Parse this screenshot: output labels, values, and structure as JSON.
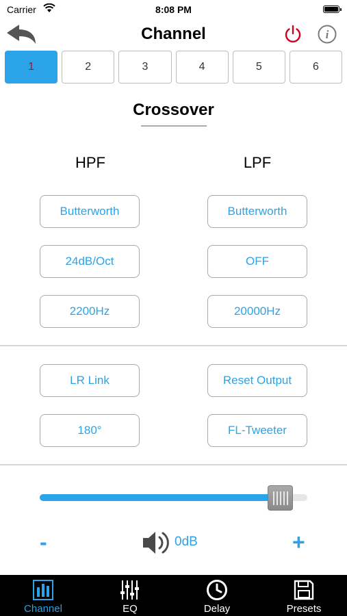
{
  "status_bar": {
    "carrier": "Carrier",
    "time": "8:08 PM"
  },
  "header": {
    "title": "Channel"
  },
  "channels": [
    {
      "label": "1",
      "active": true
    },
    {
      "label": "2",
      "active": false
    },
    {
      "label": "3",
      "active": false
    },
    {
      "label": "4",
      "active": false
    },
    {
      "label": "5",
      "active": false
    },
    {
      "label": "6",
      "active": false
    }
  ],
  "crossover": {
    "title": "Crossover",
    "hpf": {
      "heading": "HPF",
      "type": "Butterworth",
      "slope": "24dB/Oct",
      "frequency": "2200Hz"
    },
    "lpf": {
      "heading": "LPF",
      "type": "Butterworth",
      "slope": "OFF",
      "frequency": "20000Hz"
    }
  },
  "controls": {
    "lr_link": "LR Link",
    "reset_output": "Reset Output",
    "phase": "180°",
    "output_name": "FL-Tweeter"
  },
  "volume": {
    "minus": "-",
    "plus": "+",
    "level_label": "0dB",
    "slider_fraction": 0.9
  },
  "tabbar": [
    {
      "label": "Channel",
      "icon": "bar-chart-icon",
      "active": true
    },
    {
      "label": "EQ",
      "icon": "equalizer-sliders-icon",
      "active": false
    },
    {
      "label": "Delay",
      "icon": "clock-icon",
      "active": false
    },
    {
      "label": "Presets",
      "icon": "floppy-disk-icon",
      "active": false
    }
  ],
  "colors": {
    "accent": "#2aa3e8",
    "active_channel_text": "#d0021b",
    "power": "#d0021b"
  }
}
